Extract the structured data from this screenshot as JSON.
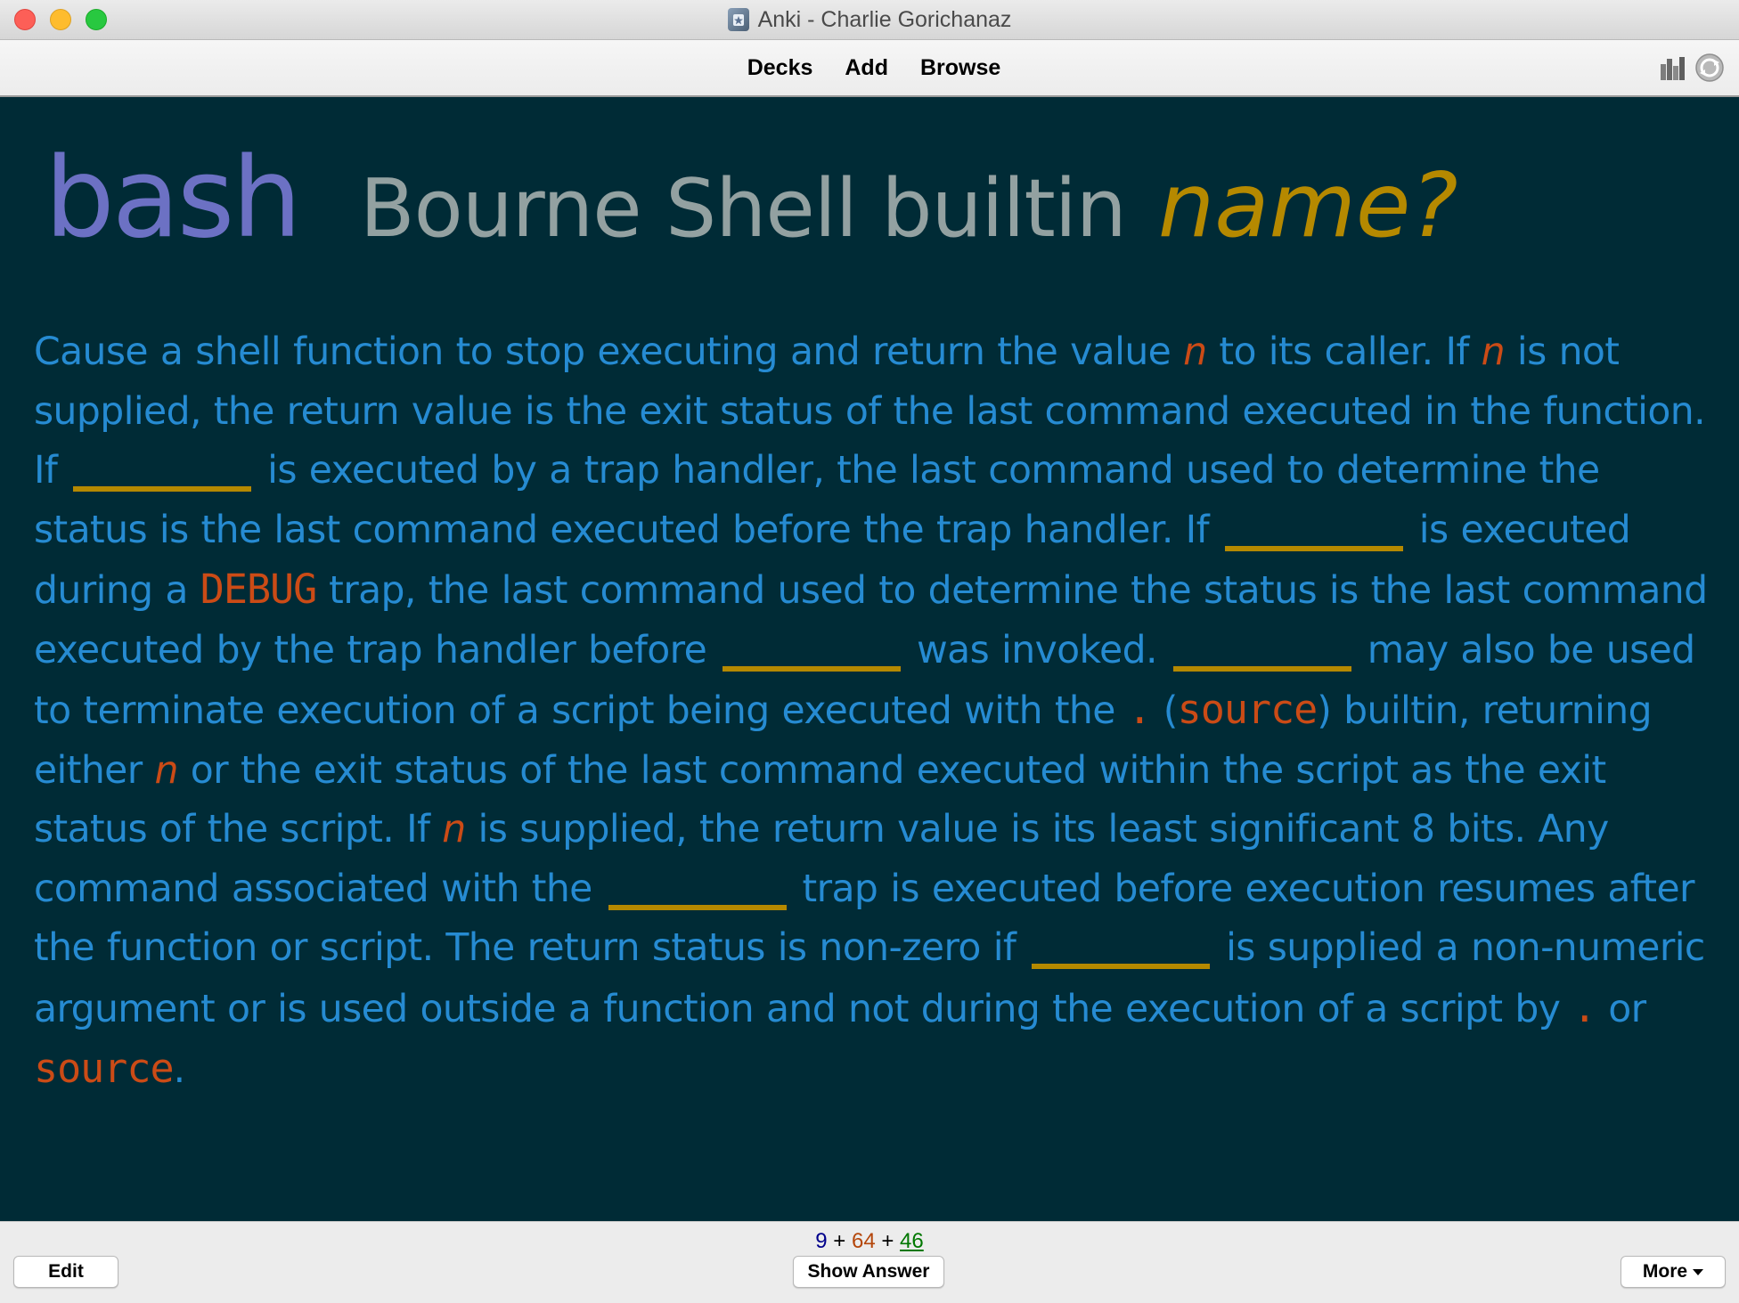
{
  "window": {
    "title": "Anki - Charlie Gorichanaz"
  },
  "toolbar": {
    "decks": "Decks",
    "add": "Add",
    "browse": "Browse"
  },
  "card": {
    "title": {
      "topic": "bash",
      "description": "Bourne Shell builtin",
      "question": "name?"
    },
    "text": [
      "Cause a shell function to stop executing and return the value ",
      "n",
      " to its caller. If ",
      "n",
      " is not supplied, the return value is the exit status of the last command executed in the function. If ",
      " is executed by a trap handler, the last command used to determine the status is the last command executed before the trap handler. If ",
      " is executed during a ",
      "DEBUG",
      " trap, the last command used to determine the status is the last command executed by the trap handler before ",
      " was invoked. ",
      " may also be used to terminate execution of a script being executed with the ",
      ".",
      " (",
      "source",
      ") builtin, returning either ",
      "n",
      " or the exit status of the last command executed within the script as the exit status of the script. If ",
      "n",
      " is supplied, the return value is its least significant 8 bits. Any command associated with the ",
      " trap is executed before execution resumes after the function or script. The return status is non-zero if ",
      " is supplied a non-numeric argument or is used outside a function and not during the execution of a script by ",
      ".",
      " or ",
      "source",
      "."
    ]
  },
  "bottom": {
    "edit": "Edit",
    "show_answer": "Show Answer",
    "more": "More",
    "counts": {
      "new": "9",
      "learning": "64",
      "review": "46",
      "sep": "+"
    }
  },
  "colors": {
    "card_background": "#002b36",
    "text": "#268bd2",
    "topic": "#6c71c4",
    "description": "#93a1a1",
    "question": "#b58900",
    "code": "#cb4b16",
    "cloze_blank": "#b58900"
  },
  "icons": [
    "app-icon",
    "stats-icon",
    "sync-icon",
    "caret-down-icon"
  ]
}
